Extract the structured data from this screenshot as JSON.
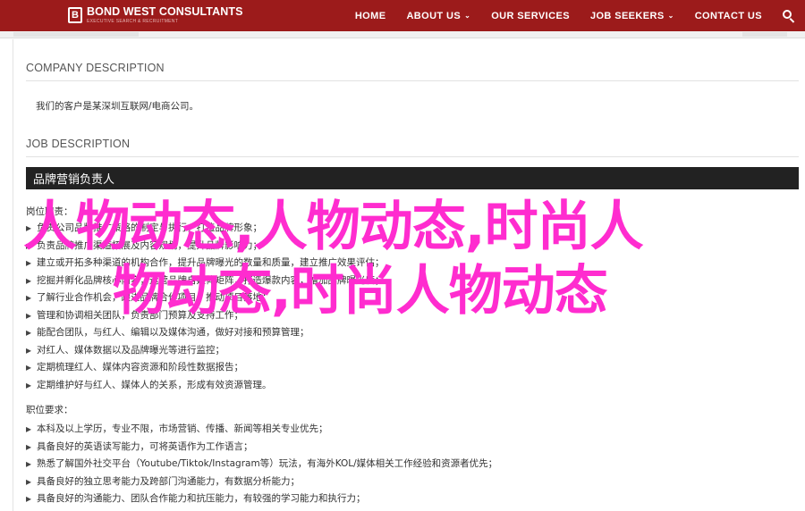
{
  "header": {
    "logo_mark": "B",
    "logo_name": "BOND WEST CONSULTANTS",
    "logo_tagline": "EXECUTIVE SEARCH & RECRUITMENT",
    "nav": [
      {
        "label": "HOME",
        "dropdown": false
      },
      {
        "label": "ABOUT US",
        "dropdown": true
      },
      {
        "label": "OUR SERVICES",
        "dropdown": false
      },
      {
        "label": "JOB SEEKERS",
        "dropdown": true
      },
      {
        "label": "CONTACT US",
        "dropdown": false
      }
    ],
    "chevron": "⌄",
    "bg_color": "#9c1b1b"
  },
  "company": {
    "heading": "COMPANY DESCRIPTION",
    "text": "我们的客户是某深圳互联网/电商公司。"
  },
  "job": {
    "heading": "JOB DESCRIPTION",
    "title": "品牌营销负责人",
    "duties_label": "岗位职责：",
    "duties": [
      "负责公司品牌推广策略的制定与执行，打造品牌形象；",
      "负责品牌推广渠道拓展及内容规划，提升品牌影响力；",
      "建立或开拓多种渠道的机构合作，提升品牌曝光的数量和质量，建立推广效果评估；",
      "挖掘并孵化品牌核心内容，运营品牌自媒体矩阵，打造爆款内容，增加品牌曝光度；",
      "了解行业合作机会，跟进品牌合作项目，推动项目落地；",
      "管理和协调相关团队，负责部门预算及支持工作；",
      "能配合团队，与红人、编辑以及媒体沟通，做好对接和预算管理；",
      "对红人、媒体数据以及品牌曝光等进行监控；",
      "定期梳理红人、媒体内容资源和阶段性数据报告；",
      "定期维护好与红人、媒体人的关系，形成有效资源管理。"
    ],
    "req_label": "职位要求：",
    "requirements": [
      "本科及以上学历，专业不限，市场营销、传播、新闻等相关专业优先；",
      "具备良好的英语读写能力，可将英语作为工作语言；",
      "熟悉了解国外社交平台（Youtube/Tiktok/Instagram等）玩法，有海外KOL/媒体相关工作经验和资源者优先；",
      "具备良好的独立思考能力及跨部门沟通能力，有数据分析能力；",
      "具备良好的沟通能力、团队合作能力和抗压能力，有较强的学习能力和执行力；"
    ],
    "bullet": "▸"
  },
  "overlay": {
    "line1": "人物动态,人物动态,时尚人",
    "line2": "物动态,时尚人物动态",
    "color": "#ff2ccf"
  }
}
